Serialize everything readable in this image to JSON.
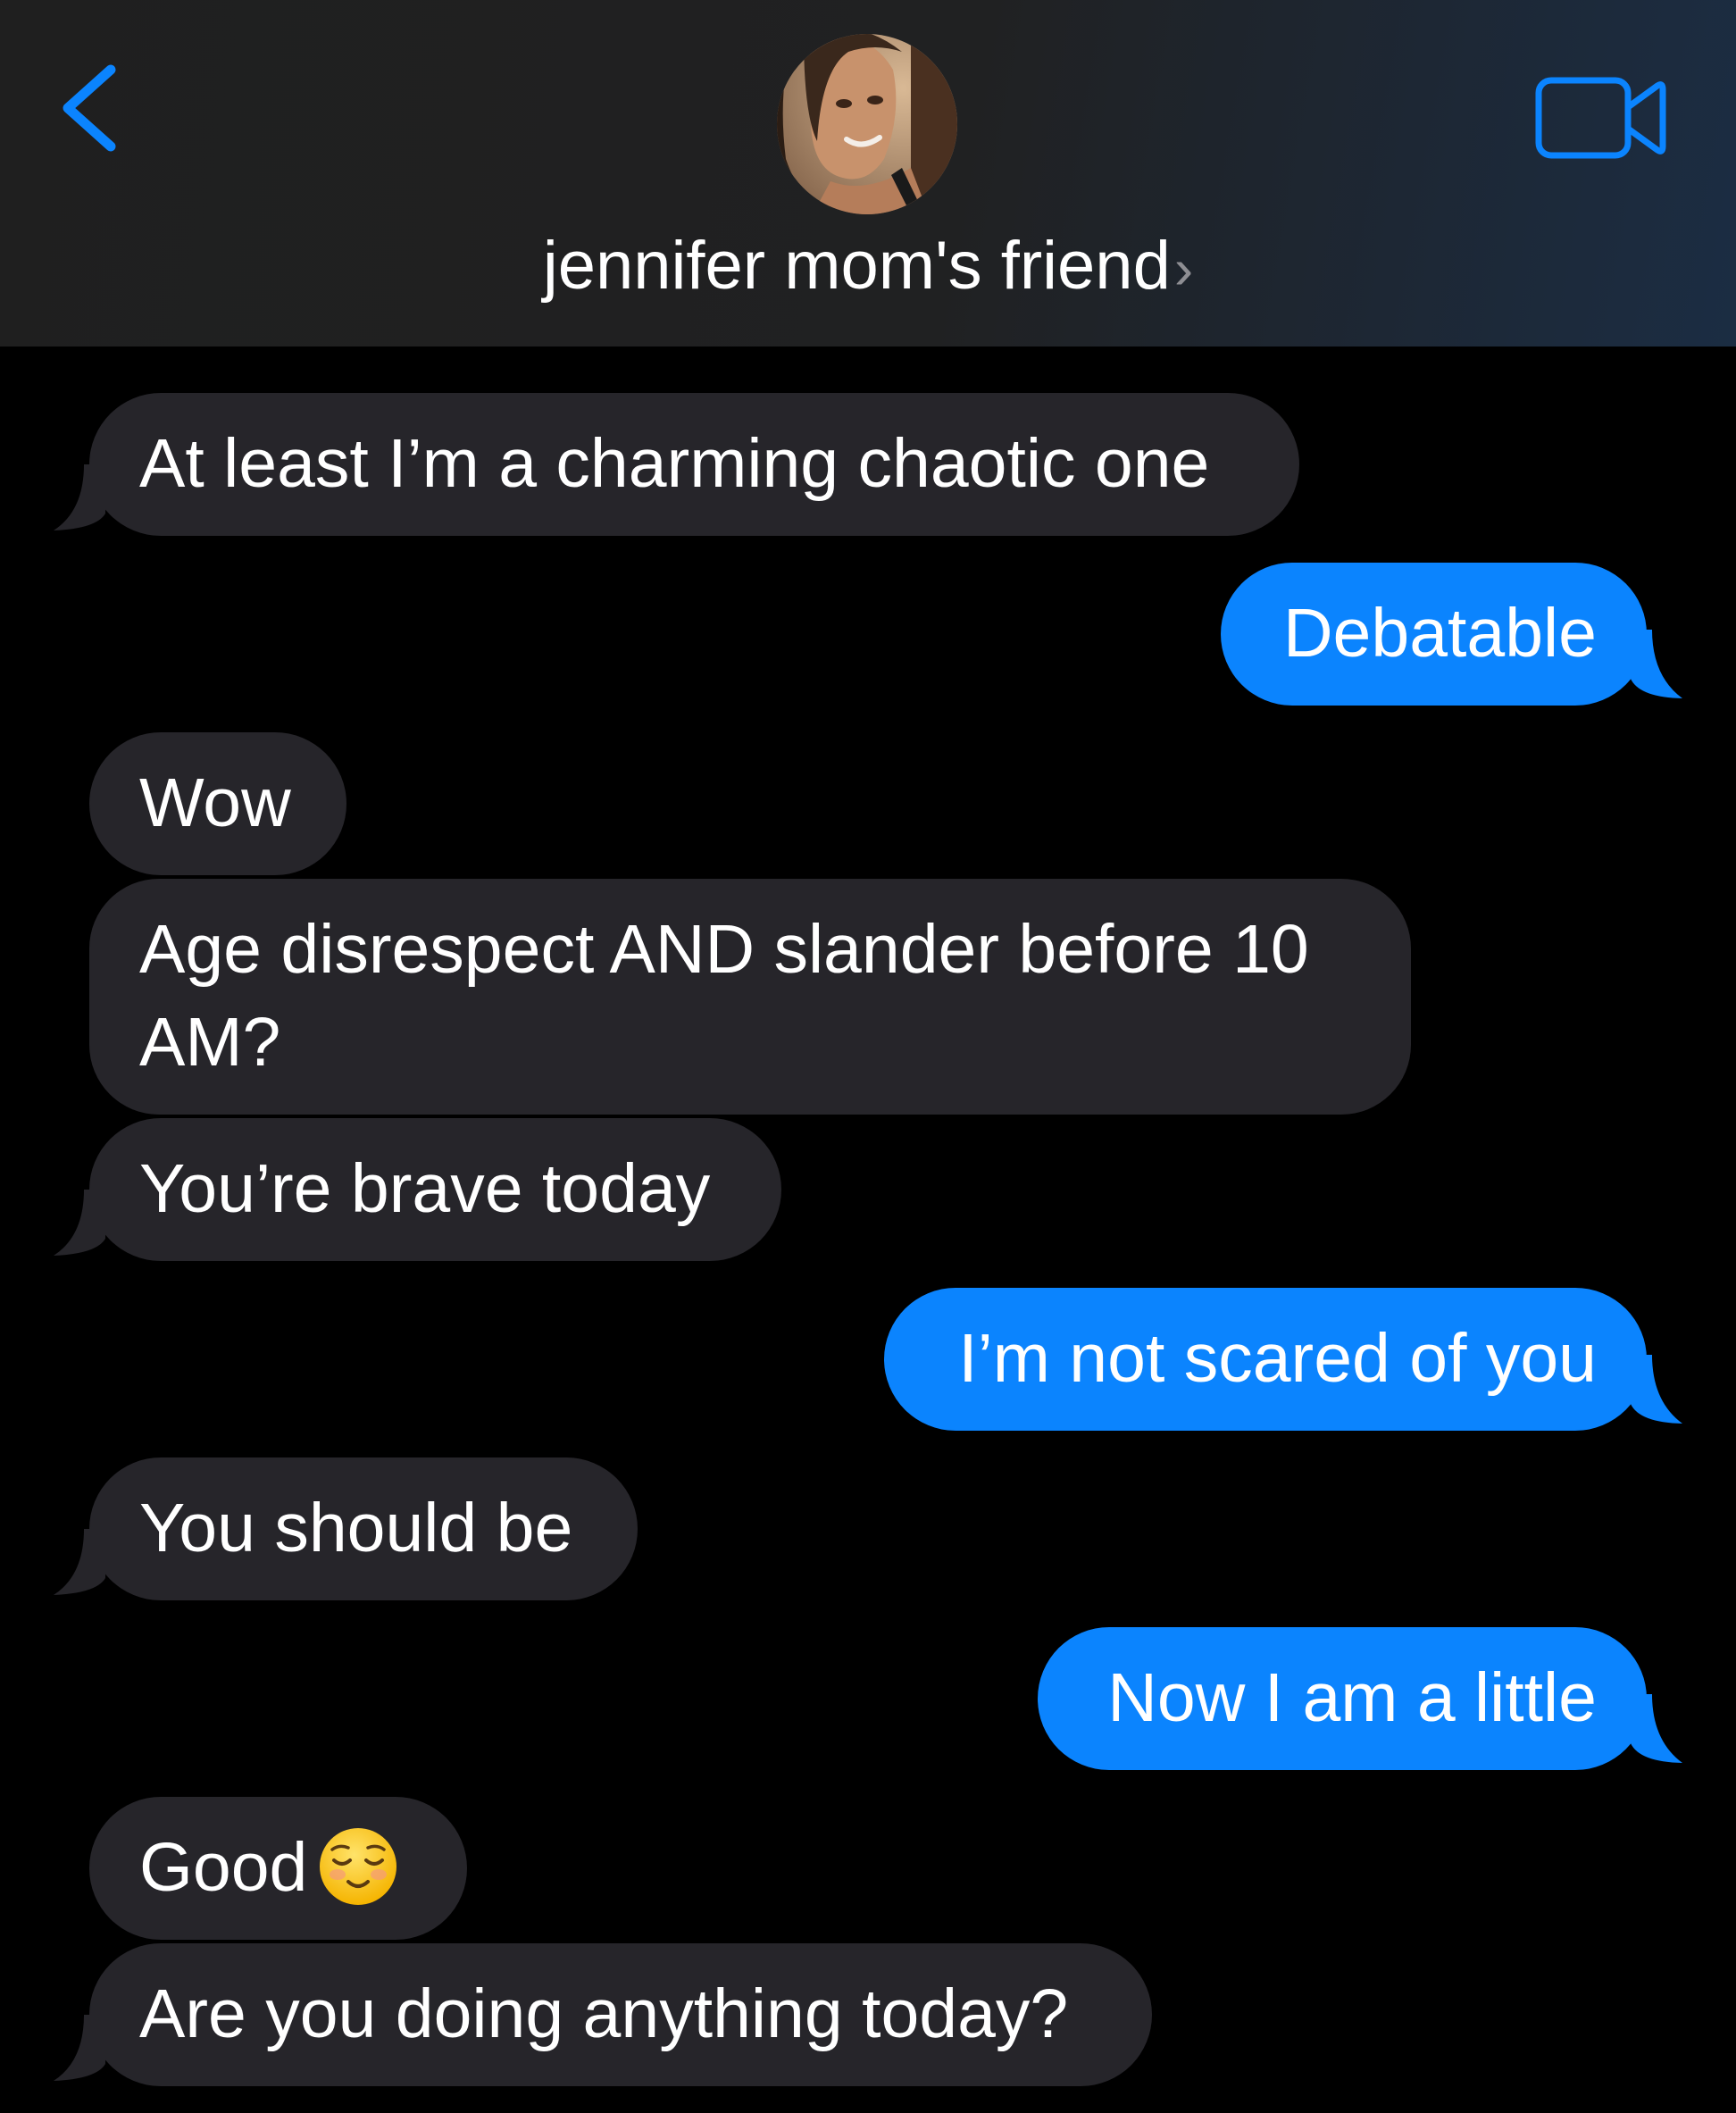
{
  "header": {
    "contact_name": "jennifer mom's friend",
    "chevron": "›",
    "back_icon": "chevron-left-icon",
    "video_icon": "video-camera-icon",
    "accent_color": "#0b84fe"
  },
  "messages": [
    {
      "sender": "them",
      "text": "At least I’m a charming chaotic one"
    },
    {
      "sender": "me",
      "text": "Debatable"
    },
    {
      "sender": "them",
      "text": "Wow"
    },
    {
      "sender": "them",
      "text": "Age disrespect AND slander before 10 AM?"
    },
    {
      "sender": "them",
      "text": "You’re brave today"
    },
    {
      "sender": "me",
      "text": "I’m not scared of you"
    },
    {
      "sender": "them",
      "text": "You should be"
    },
    {
      "sender": "me",
      "text": "Now I am a little"
    },
    {
      "sender": "them",
      "text": "Good",
      "emoji": "relieved-face-emoji"
    },
    {
      "sender": "them",
      "text": "Are you doing anything today?"
    }
  ],
  "colors": {
    "incoming_bubble": "#26252a",
    "outgoing_bubble": "#0b84fe",
    "background": "#000000"
  }
}
